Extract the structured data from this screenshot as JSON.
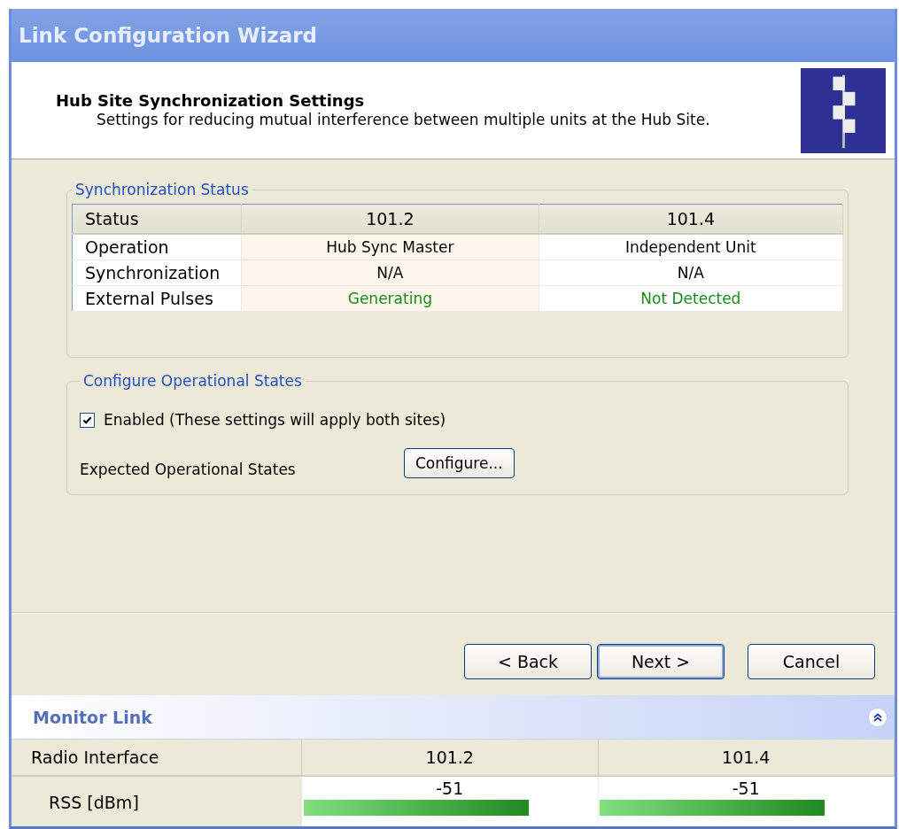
{
  "window": {
    "title": "Link Configuration Wizard"
  },
  "header": {
    "title": "Hub Site Synchronization Settings",
    "description": "Settings for reducing mutual interference between multiple units at the Hub Site."
  },
  "sync_status": {
    "legend": "Synchronization Status",
    "columns": [
      "Status",
      "101.2",
      "101.4"
    ],
    "rows": [
      {
        "cells": [
          {
            "text": "Operation",
            "kind": "label"
          },
          {
            "text": "Hub Sync Master",
            "kind": "plain"
          },
          {
            "text": "Independent Unit",
            "kind": "plain"
          }
        ]
      },
      {
        "cells": [
          {
            "text": "Synchronization",
            "kind": "label"
          },
          {
            "text": "N/A",
            "kind": "plain"
          },
          {
            "text": "N/A",
            "kind": "plain"
          }
        ]
      },
      {
        "cells": [
          {
            "text": "External Pulses",
            "kind": "label"
          },
          {
            "text": "Generating",
            "kind": "good"
          },
          {
            "text": "Not Detected",
            "kind": "good"
          }
        ]
      }
    ]
  },
  "operational_states": {
    "legend": "Configure Operational States",
    "enabled": {
      "label": "Enabled (These settings will apply both sites)",
      "checked": true
    },
    "expected_label": "Expected Operational States",
    "configure_button": "Configure..."
  },
  "buttons": [
    {
      "label": "< Back",
      "default": false
    },
    {
      "label": "Next >",
      "default": true
    },
    {
      "label": "Cancel",
      "default": false
    }
  ],
  "monitor": {
    "title": "Monitor Link",
    "expanded": true,
    "columns": [
      "Radio Interface",
      "101.2",
      "101.4"
    ],
    "rows": [
      {
        "cells": [
          {
            "text": "RSS [dBm]",
            "kind": "label"
          },
          {
            "text": "-51",
            "kind": "meter",
            "level": 0.77
          },
          {
            "text": "-51",
            "kind": "meter",
            "level": 0.77
          }
        ]
      }
    ]
  }
}
